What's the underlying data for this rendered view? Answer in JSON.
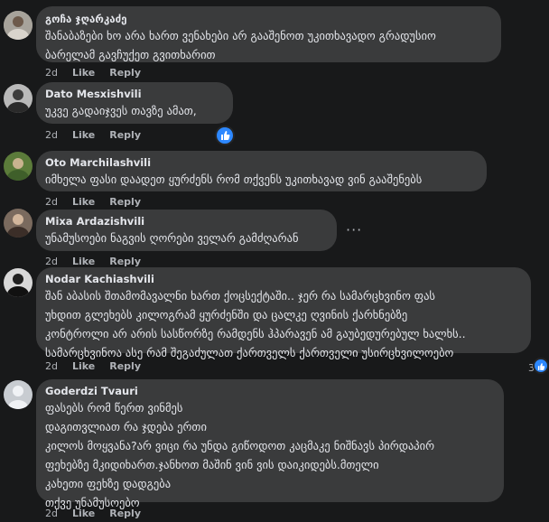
{
  "comments": [
    {
      "author": "გოჩა ჯღარკაძე",
      "lines": [
        "შანაბაზები ხო არა ხართ ვენახები არ გააშენოთ უკითხავადო გრადუსიო",
        "ბარელამ გავჩუქეთ გვითხარით"
      ],
      "time": "2d",
      "like": "Like",
      "reply": "Reply"
    },
    {
      "author": "Dato Mesxishvili",
      "lines": [
        "უკვე გადაიჯვეს თავზე ამათ,"
      ],
      "time": "2d",
      "like": "Like",
      "reply": "Reply",
      "reaction": "like"
    },
    {
      "author": "Oto Marchilashvili",
      "lines": [
        "იმხელა ფასი დაადეთ ყურძენს რომ თქვენს უკითხავად ვინ გააშენებს"
      ],
      "time": "2d",
      "like": "Like",
      "reply": "Reply"
    },
    {
      "author": "Mixa Ardazishvili",
      "lines": [
        "უნამუსოები ნაგვის ღორები ველარ გამძღარან"
      ],
      "time": "2d",
      "like": "Like",
      "reply": "Reply",
      "more": "···"
    },
    {
      "author": "Nodar Kachiashvili",
      "lines": [
        "შან აბასის შთამომავალნი ხართ ქოცსექტაში.. ჯერ რა სამარცხვინო ფას",
        "უხდით გლეხებს კილოგრამ ყურძენში და ცალკე ღვინის ქარხნებზე",
        "კონტროლი არ არის სასწორზე რამდენს ჰპარავენ ამ გაუბედურებულ ხალხს..",
        "სამარცხვინოა ასე რამ შეგაძულათ ქართველს ქართველი უსირცხვილოებო"
      ],
      "time": "2d",
      "like": "Like",
      "reply": "Reply",
      "replies_count": "3"
    },
    {
      "author": "Goderdzi Tvauri",
      "lines": [
        "ფასებს რომ წერთ ვინმეს",
        "დაგითვლიათ რა ჯდება ერთი",
        "კილოს მოყვანა?არ ვიცი რა უნდა გიწოდოთ კაცმაკე ნიშნავს პირდაპირ",
        "ფეხებზე მკიდიხართ.ჯანხოთ მაშინ ვინ ვის დაიკიდებს.მთელი",
        "კახეთი ფეხზე დადგება",
        "თქვე უნამუსოებო"
      ],
      "time": "2d",
      "like": "Like",
      "reply": "Reply"
    }
  ],
  "colors": {
    "background": "#18191a",
    "bubble": "#3a3b3c",
    "text": "#e4e6eb",
    "secondary": "#b0b3b8",
    "like_blue": "#2d88ff"
  }
}
